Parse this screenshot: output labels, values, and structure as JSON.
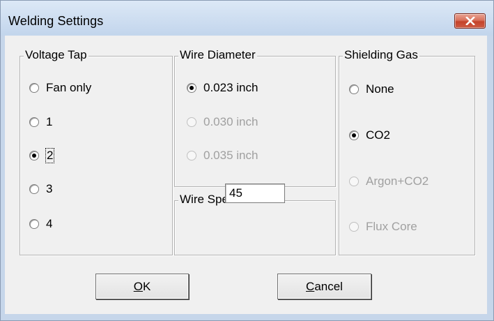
{
  "window": {
    "title": "Welding Settings"
  },
  "groups": {
    "voltage_tap": {
      "label": "Voltage Tap",
      "options": [
        "Fan only",
        "1",
        "2",
        "3",
        "4"
      ],
      "selected": "2"
    },
    "wire_diameter": {
      "label": "Wire Diameter",
      "options": [
        "0.023 inch",
        "0.030 inch",
        "0.035 inch"
      ],
      "selected": "0.023 inch"
    },
    "wire_speed": {
      "label": "Wire Speed",
      "value": "45"
    },
    "shielding_gas": {
      "label": "Shielding Gas",
      "options": [
        "None",
        "CO2",
        "Argon+CO2",
        "Flux Core"
      ],
      "selected": "CO2"
    }
  },
  "buttons": {
    "ok": {
      "mnemonic": "O",
      "rest": "K"
    },
    "cancel": {
      "mnemonic": "C",
      "rest": "ancel"
    }
  },
  "colors": {
    "disabled_text": "#a0a0a0",
    "close_button": "#c4432b"
  }
}
